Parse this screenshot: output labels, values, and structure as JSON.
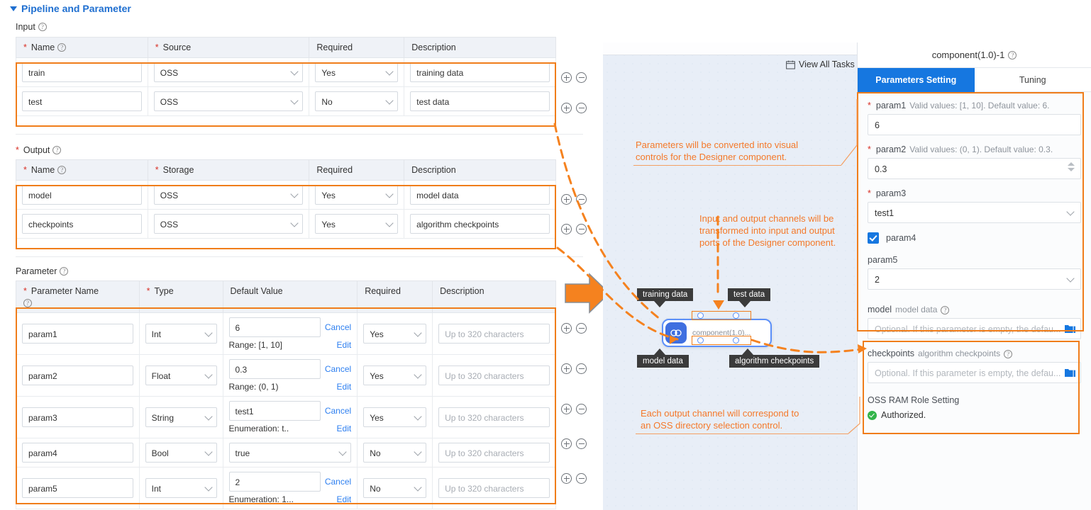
{
  "page": {
    "section_title": "Pipeline and Parameter",
    "accent_orange": "#f07d1a",
    "accent_blue": "#1677e0"
  },
  "input_section": {
    "label": "Input",
    "headers": [
      "* Name",
      "* Source",
      "Required",
      "Description"
    ],
    "header_name": "Name",
    "header_source": "Source",
    "header_required": "Required",
    "header_description": "Description",
    "rows": [
      {
        "name": "train",
        "source": "OSS",
        "required": "Yes",
        "description": "training data"
      },
      {
        "name": "test",
        "source": "OSS",
        "required": "No",
        "description": "test data"
      }
    ]
  },
  "output_section": {
    "label": "Output",
    "header_name": "Name",
    "header_storage": "Storage",
    "header_required": "Required",
    "header_description": "Description",
    "rows": [
      {
        "name": "model",
        "storage": "OSS",
        "required": "Yes",
        "description": "model data"
      },
      {
        "name": "checkpoints",
        "storage": "OSS",
        "required": "Yes",
        "description": "algorithm checkpoints"
      }
    ]
  },
  "parameter_section": {
    "label": "Parameter",
    "header_name": "Parameter Name",
    "header_type": "Type",
    "header_default": "Default Value",
    "header_required": "Required",
    "header_description": "Description",
    "cancel_label": "Cancel",
    "edit_label": "Edit",
    "description_placeholder": "Up to 320 characters",
    "rows": [
      {
        "name": "param1",
        "type": "Int",
        "default": "6",
        "constraint": "Range: [1, 10]",
        "required": "Yes",
        "has_links": true,
        "is_select": false
      },
      {
        "name": "param2",
        "type": "Float",
        "default": "0.3",
        "constraint": "Range: (0, 1)",
        "required": "Yes",
        "has_links": true,
        "is_select": false
      },
      {
        "name": "param3",
        "type": "String",
        "default": "test1",
        "constraint": "Enumeration: t..",
        "required": "Yes",
        "has_links": true,
        "is_select": false
      },
      {
        "name": "param4",
        "type": "Bool",
        "default": "true",
        "constraint": "",
        "required": "No",
        "has_links": false,
        "is_select": true
      },
      {
        "name": "param5",
        "type": "Int",
        "default": "2",
        "constraint": "Enumeration: 1...",
        "required": "No",
        "has_links": true,
        "is_select": false
      }
    ]
  },
  "annotations": [
    {
      "id": "ann-parameters",
      "line1": "Parameters will be converted into visual",
      "line2": "controls for the Designer component."
    },
    {
      "id": "ann-channels",
      "line1": "Input and output channels will be",
      "line2": "transformed into input and output",
      "line3": "ports of the Designer component."
    },
    {
      "id": "ann-oss",
      "line1": "Each output channel will correspond to",
      "line2": "an OSS directory selection control."
    }
  ],
  "canvas": {
    "view_all_tasks": "View All Tasks",
    "node_title": "component(1.0)...",
    "node_icon": "component-icon",
    "labels": {
      "training_data": "training data",
      "test_data": "test data",
      "model_data": "model data",
      "algorithm_checkpoints": "algorithm checkpoints"
    }
  },
  "right_panel": {
    "title": "component(1.0)-1",
    "tabs": [
      {
        "label": "Parameters Setting",
        "active": true
      },
      {
        "label": "Tuning",
        "active": false
      }
    ],
    "fields": [
      {
        "name": "param1",
        "required": true,
        "hint": "Valid values: [1, 10]. Default value: 6.",
        "value": "6",
        "control": "text"
      },
      {
        "name": "param2",
        "required": true,
        "hint": "Valid values: (0, 1). Default value: 0.3.",
        "value": "0.3",
        "control": "number"
      },
      {
        "name": "param3",
        "required": true,
        "hint": "",
        "value": "test1",
        "control": "select"
      },
      {
        "name": "param4",
        "required": false,
        "hint": "",
        "value": "",
        "control": "checkbox",
        "checked": true
      },
      {
        "name": "param5",
        "required": false,
        "hint": "",
        "value": "2",
        "control": "select"
      }
    ],
    "outputs": [
      {
        "name": "model",
        "hint": "model data",
        "placeholder": "Optional. If this parameter is empty, the defau..."
      },
      {
        "name": "checkpoints",
        "hint": "algorithm checkpoints",
        "placeholder": "Optional. If this parameter is empty, the defau..."
      }
    ],
    "oss": {
      "title": "OSS RAM Role Setting",
      "status": "Authorized."
    }
  }
}
